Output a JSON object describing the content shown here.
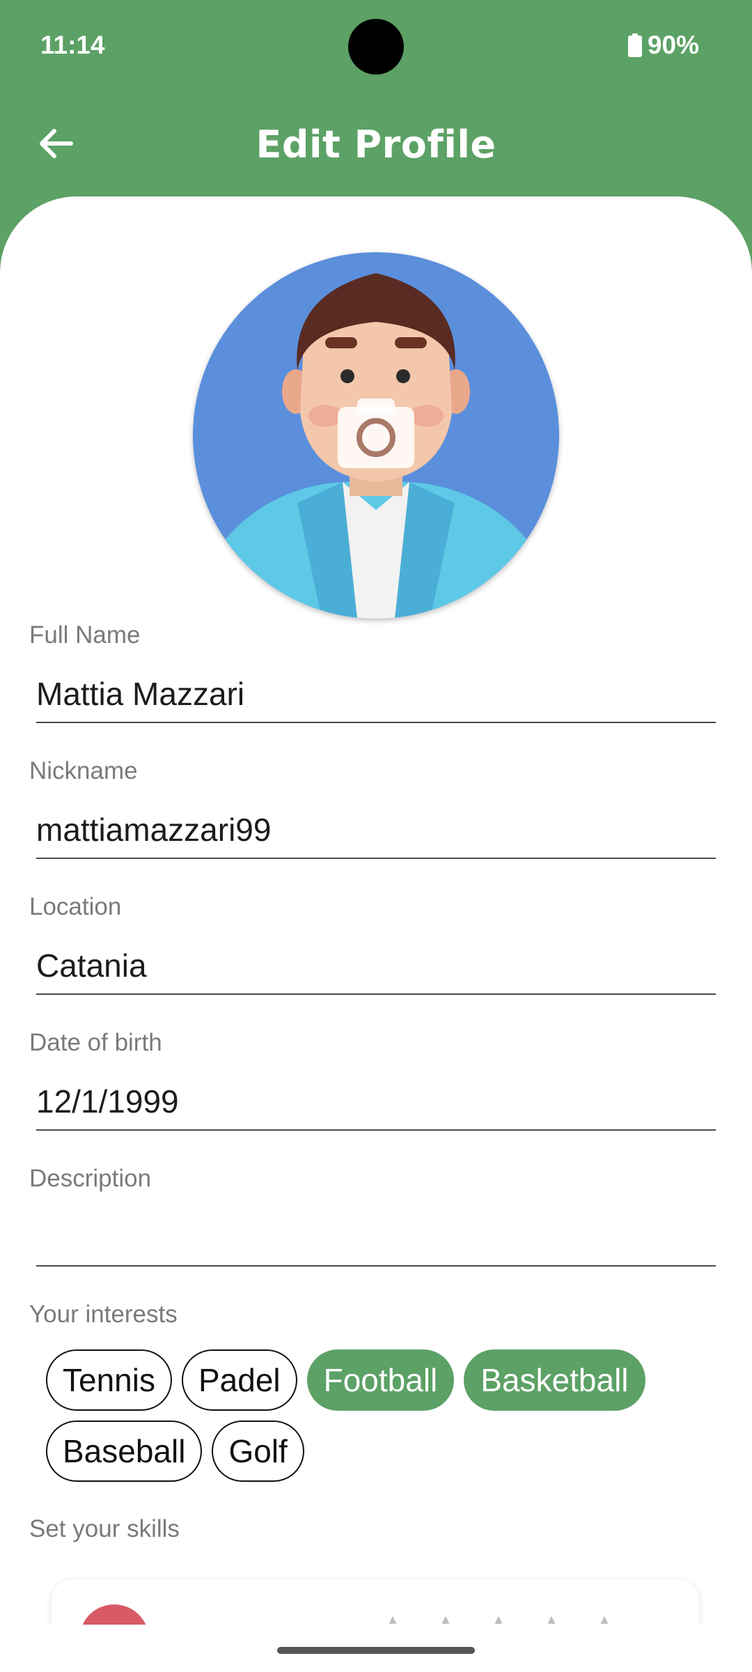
{
  "status_bar": {
    "time": "11:14",
    "battery": "90%"
  },
  "app_bar": {
    "title": "Edit Profile",
    "back_icon": "arrow-left-icon"
  },
  "avatar": {
    "overlay_icon": "camera-icon"
  },
  "fields": {
    "full_name": {
      "label": "Full Name",
      "value": "Mattia Mazzari"
    },
    "nickname": {
      "label": "Nickname",
      "value": "mattiamazzari99"
    },
    "location": {
      "label": "Location",
      "value": "Catania"
    },
    "date_of_birth": {
      "label": "Date of birth",
      "value": "12/1/1999"
    },
    "description": {
      "label": "Description",
      "value": ""
    }
  },
  "interests": {
    "label": "Your interests",
    "chips": [
      {
        "label": "Tennis",
        "selected": false
      },
      {
        "label": "Padel",
        "selected": false
      },
      {
        "label": "Football",
        "selected": true
      },
      {
        "label": "Basketball",
        "selected": true
      },
      {
        "label": "Baseball",
        "selected": false
      },
      {
        "label": "Golf",
        "selected": false
      }
    ]
  },
  "skills": {
    "label": "Set your skills"
  },
  "colors": {
    "primary": "#5ca165",
    "label_gray": "#7a7a7a",
    "text": "#1c1c1c"
  }
}
